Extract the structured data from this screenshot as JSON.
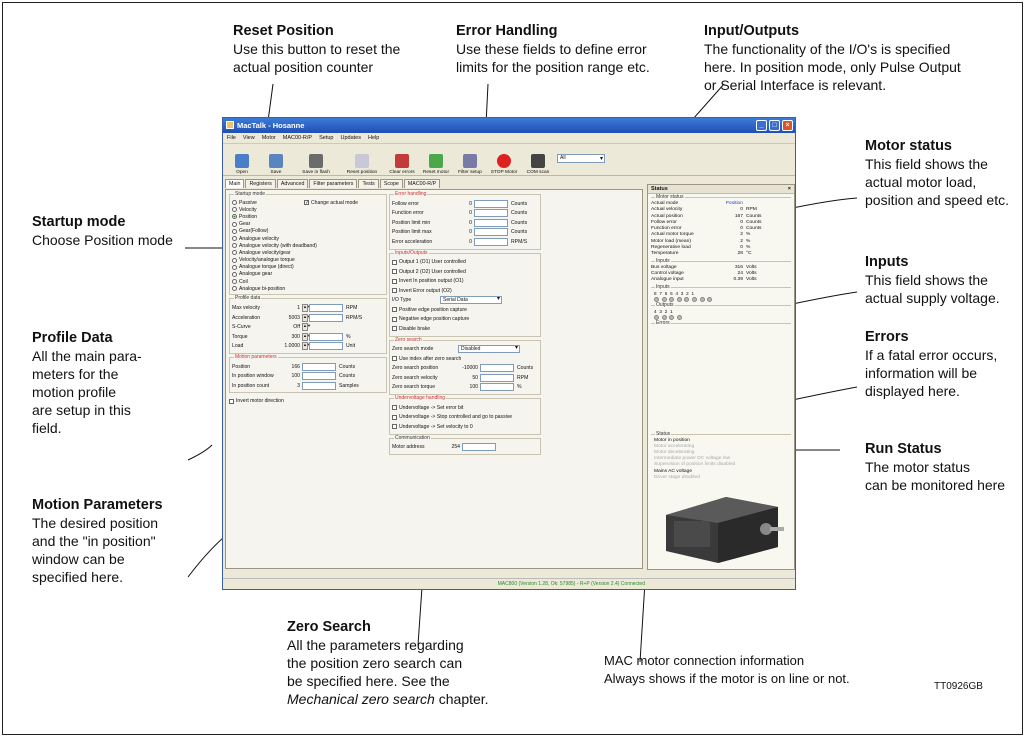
{
  "annotations": {
    "reset": {
      "title": "Reset Position",
      "lines": [
        "Use this button to reset the",
        "actual position counter"
      ]
    },
    "error": {
      "title": "Error Handling",
      "lines": [
        "Use these fields to define error",
        "limits for the position range etc."
      ]
    },
    "io": {
      "title": "Input/Outputs",
      "lines": [
        "The functionality of the I/O's is specified",
        "here. In position mode, only Pulse Output",
        "or Serial Interface is relevant."
      ]
    },
    "motor_status": {
      "title": "Motor status",
      "lines": [
        "This field shows the",
        "actual motor load,",
        "position and speed etc."
      ]
    },
    "inputs": {
      "title": "Inputs",
      "lines": [
        "This field shows the",
        "actual supply voltage."
      ]
    },
    "errors": {
      "title": "Errors",
      "lines": [
        "If a fatal error occurs,",
        "information will be",
        "displayed here."
      ]
    },
    "run_status": {
      "title": "Run Status",
      "lines": [
        "The motor status",
        "can be monitored here"
      ]
    },
    "startup": {
      "title": "Startup mode",
      "lines": [
        "Choose Position mode"
      ]
    },
    "profile": {
      "title": "Profile Data",
      "lines": [
        "All the main para-",
        "meters for the",
        "motion profile",
        "are setup in this",
        "field."
      ]
    },
    "motion": {
      "title": "Motion Parameters",
      "lines": [
        "The desired position",
        "and the \"in position\"",
        "window can be",
        "specified here."
      ]
    },
    "zero": {
      "title": "Zero Search",
      "lines": [
        "All the parameters regarding",
        "the position zero search can",
        "be specified here. See the"
      ],
      "italic": "Mechanical zero search",
      "tail": " chapter."
    },
    "mac": {
      "lines": [
        "MAC motor connection information",
        "Always shows if the motor is on line or not."
      ]
    },
    "ref": "TT0926GB"
  },
  "app": {
    "title": "MacTalk - Hosanne",
    "menu": [
      "File",
      "View",
      "Motor",
      "MAC00-R/P",
      "Setup",
      "Updates",
      "Help"
    ],
    "toolbar": [
      {
        "label": "Open",
        "color": "#4a7fc8"
      },
      {
        "label": "Save",
        "color": "#5a86c0"
      },
      {
        "label": "Save in flash",
        "color": "#6b6b6b"
      },
      {
        "label": "Reset position",
        "color": "#c8c8d8"
      },
      {
        "label": "Clear errors",
        "color": "#c33a3a"
      },
      {
        "label": "Reset motor",
        "color": "#4aa84a"
      },
      {
        "label": "Filter setup",
        "color": "#7a7aa8"
      },
      {
        "label": "STOP Motor",
        "color": "#e02020"
      },
      {
        "label": "COM scan",
        "color": "#444"
      }
    ],
    "combo": "All",
    "tabs": [
      "Main",
      "Registers",
      "Advanced",
      "Filter parameters",
      "Tests",
      "Scope",
      "MAC00-R/P"
    ],
    "startup": {
      "title": "Startup mode",
      "change": "Change actual mode",
      "modes": [
        "Passive",
        "Velocity",
        "Position",
        "Gear",
        "Gear(Follow)",
        "Analogue velocity",
        "Analogue velocity (with deadband)",
        "Analogue velocity/gear",
        "Velocity/analogue torque",
        "Analogue torque (direct)",
        "Analogue gear",
        "Coil",
        "Analogue bi-position"
      ],
      "selected": 2
    },
    "profile": {
      "title": "Profile data",
      "rows": [
        {
          "label": "Max velocity",
          "value": "1",
          "unit": "RPM"
        },
        {
          "label": "Acceleration",
          "value": "5003",
          "unit": "RPM/S"
        },
        {
          "label": "S-Curve",
          "value": "Off",
          "unit": ""
        },
        {
          "label": "Torque",
          "value": "300",
          "unit": "%"
        },
        {
          "label": "Load",
          "value": "1.0000",
          "unit": "Unit"
        }
      ]
    },
    "motion": {
      "title": "Motion parameters",
      "rows": [
        {
          "label": "Position",
          "value": "166",
          "unit": "Counts"
        },
        {
          "label": "In position window",
          "value": "100",
          "unit": "Counts"
        },
        {
          "label": "In position count",
          "value": "3",
          "unit": "Samples"
        }
      ],
      "invert": "Invert motor direction"
    },
    "error": {
      "title": "Error handling",
      "rows": [
        {
          "label": "Follow error",
          "value": "0",
          "unit": "Counts"
        },
        {
          "label": "Function error",
          "value": "0",
          "unit": "Counts"
        },
        {
          "label": "Position limit min",
          "value": "0",
          "unit": "Counts"
        },
        {
          "label": "Position limit max",
          "value": "0",
          "unit": "Counts"
        },
        {
          "label": "Error acceleration",
          "value": "0",
          "unit": "RPM/S"
        }
      ]
    },
    "io": {
      "title": "Inputs/Outputs",
      "checks": [
        "Output 1 (O1) User controlled",
        "Output 2 (O2) User controlled",
        "Invert In position output (O1)",
        "Invert Error output (O2)"
      ],
      "type_label": "I/O Type",
      "type_value": "Serial Data",
      "checks2": [
        "Positive edge position capture",
        "Negative edge position capture",
        "Disable brake"
      ]
    },
    "zero": {
      "title": "Zero search",
      "mode_label": "Zero search mode",
      "mode_value": "Disabled",
      "index": "Use index after zero search",
      "rows": [
        {
          "label": "Zero search position",
          "value": "-10000",
          "unit": "Counts"
        },
        {
          "label": "Zero search velocity",
          "value": "50",
          "unit": "RPM"
        },
        {
          "label": "Zero search torque",
          "value": "100",
          "unit": "%"
        }
      ]
    },
    "under": {
      "title": "Undervoltage handling",
      "opts": [
        "Undervoltage -> Set error bit",
        "Undervoltage -> Stop controlled and go to passive",
        "Undervoltage -> Set velocity to 0"
      ]
    },
    "comm": {
      "title": "Communication",
      "label": "Motor address",
      "value": "254"
    },
    "status": {
      "title": "Status",
      "motor_title": "Motor status",
      "motor": [
        {
          "k": "Actual mode",
          "v": "Position",
          "u": ""
        },
        {
          "k": "Actual velocity",
          "v": "0",
          "u": "RPM"
        },
        {
          "k": "Actual position",
          "v": "167",
          "u": "Counts"
        },
        {
          "k": "Follow error",
          "v": "0",
          "u": "Counts"
        },
        {
          "k": "Function error",
          "v": "0",
          "u": "Counts"
        },
        {
          "k": "Actual motor torque",
          "v": "2",
          "u": "%"
        },
        {
          "k": "Motor load (mean)",
          "v": "2",
          "u": "%"
        },
        {
          "k": "Regenerative load",
          "v": "0",
          "u": "%"
        },
        {
          "k": "Temperature",
          "v": "28",
          "u": "°C"
        }
      ],
      "inputs_title": "Inputs",
      "inputs": [
        {
          "k": "Bus voltage",
          "v": "316",
          "u": "Volts"
        },
        {
          "k": "Control voltage",
          "v": "24",
          "u": "Volts"
        },
        {
          "k": "Analogue input",
          "v": "0.39",
          "u": "Volts"
        }
      ],
      "in_title": "Inputs",
      "in_nums": [
        "8",
        "7",
        "6",
        "5",
        "4",
        "3",
        "2",
        "1"
      ],
      "out_title": "Outputs",
      "out_nums": [
        "4",
        "3",
        "2",
        "1"
      ],
      "errors_title": "Errors",
      "run_title": "Status",
      "run": [
        {
          "t": "Motor in position",
          "dim": false
        },
        {
          "t": "Motor accelerating",
          "dim": true
        },
        {
          "t": "Motor decelerating",
          "dim": true
        },
        {
          "t": "Intermediate power DC voltage low",
          "dim": true
        },
        {
          "t": "Supervision of position limits disabled",
          "dim": true
        },
        {
          "t": "Mains AC voltage",
          "dim": false
        },
        {
          "t": "Driver stage disabled",
          "dim": true
        }
      ]
    },
    "statusbar": "MAC800 (Version 1.28, Ok: 57985) - R+P (Version 2.4) Connected"
  }
}
